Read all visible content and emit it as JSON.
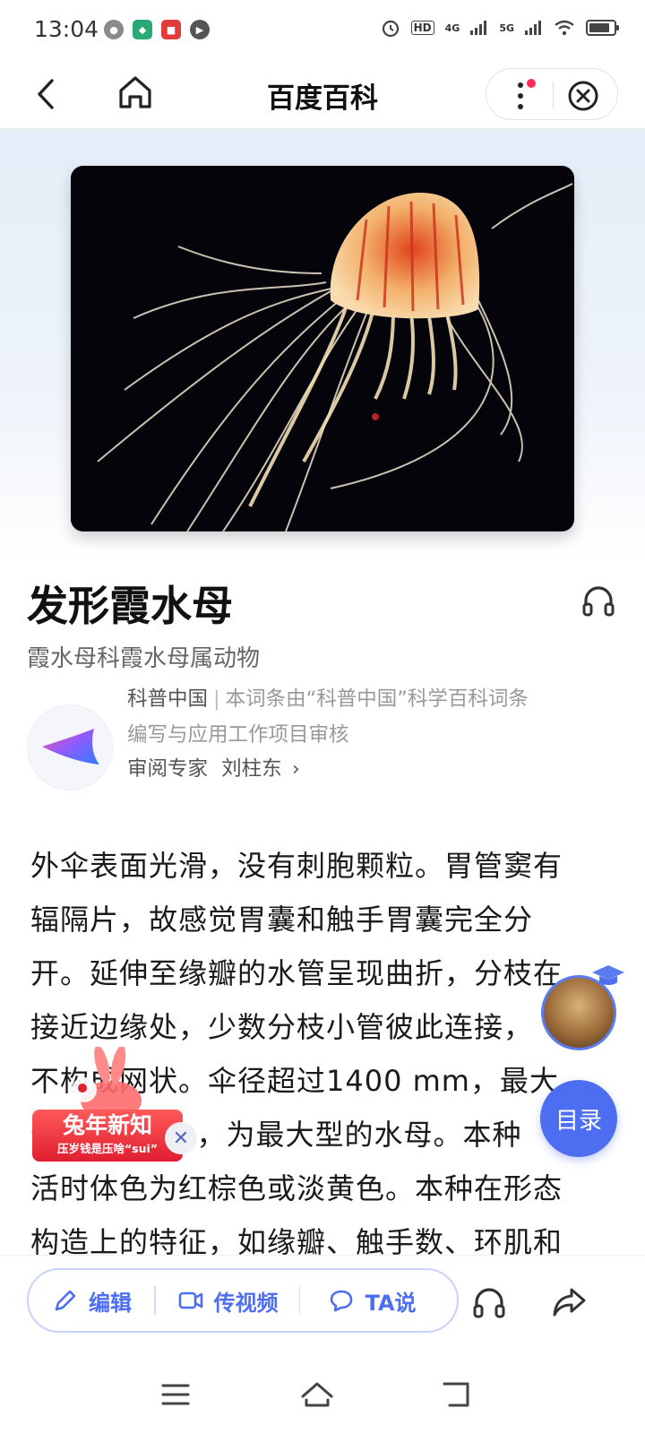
{
  "status_bar": {
    "time": "13:04",
    "hd_label": "HD",
    "net1": "4G",
    "net2": "5G"
  },
  "header": {
    "title": "百度百科"
  },
  "entry": {
    "title": "发形霞水母",
    "subtitle": "霞水母科霞水母属动物"
  },
  "review": {
    "org": "科普中国",
    "text_line1": "本词条由“科普中国”科学百科词条",
    "text_line2": "编写与应用工作项目审核",
    "expert_label": "审阅专家",
    "expert_name": "刘柱东"
  },
  "body": {
    "lines": [
      "外伞表面光滑，没有刺胞颗粒。胃管窦有",
      "辐隔片，故感觉胃囊和触手胃囊完全分",
      "开。延伸至缘瓣的水管呈现曲折，分枝在",
      "接近边缘处，少数分枝小管彼此连接，",
      "不构成网状。伞径超过1400 mm，最大",
      "个体可达1m，为最大型的水母。本种",
      "活时体色为红棕色或淡黄色。本种在形态",
      "构造上的特征，如缘瓣、触手数、环肌和"
    ]
  },
  "floating": {
    "toc_label": "目录",
    "promo_title": "兔年新知",
    "promo_sub": "压岁钱是压啥“sui”",
    "promo_close": "✕"
  },
  "toolbar": {
    "edit_label": "编辑",
    "video_label": "传视频",
    "ta_label": "TA说"
  },
  "colors": {
    "accent": "#4e6ef2",
    "promo_red": "#e01e2f"
  }
}
